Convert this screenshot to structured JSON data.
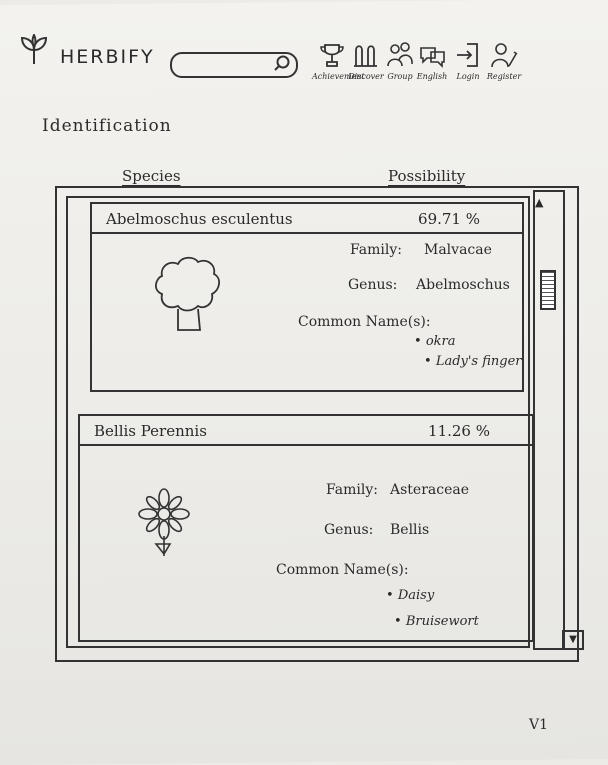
{
  "header": {
    "brand": "HERBIFY",
    "search": {
      "placeholder": ""
    },
    "nav": [
      {
        "label": "Achievement",
        "icon": "trophy-icon"
      },
      {
        "label": "Discover",
        "icon": "discover-icon"
      },
      {
        "label": "Group",
        "icon": "group-icon"
      },
      {
        "label": "English",
        "icon": "language-icon"
      },
      {
        "label": "Login",
        "icon": "login-icon"
      },
      {
        "label": "Register",
        "icon": "register-icon"
      }
    ]
  },
  "page": {
    "title": "Identification",
    "col_species": "Species",
    "col_possibility": "Possibility"
  },
  "results": [
    {
      "species": "Abelmoschus esculentus",
      "possibility": "69.71 %",
      "family_label": "Family:",
      "family": "Malvacae",
      "genus_label": "Genus:",
      "genus": "Abelmoschus",
      "common_label": "Common Name(s):",
      "common_names": [
        "okra",
        "Lady's finger"
      ],
      "image": "tree-icon"
    },
    {
      "species": "Bellis Perennis",
      "possibility": "11.26 %",
      "family_label": "Family:",
      "family": "Asteraceae",
      "genus_label": "Genus:",
      "genus": "Bellis",
      "common_label": "Common Name(s):",
      "common_names": [
        "Daisy",
        "Bruisewort"
      ],
      "image": "flower-icon"
    }
  ],
  "footer": {
    "mark": "V1"
  }
}
